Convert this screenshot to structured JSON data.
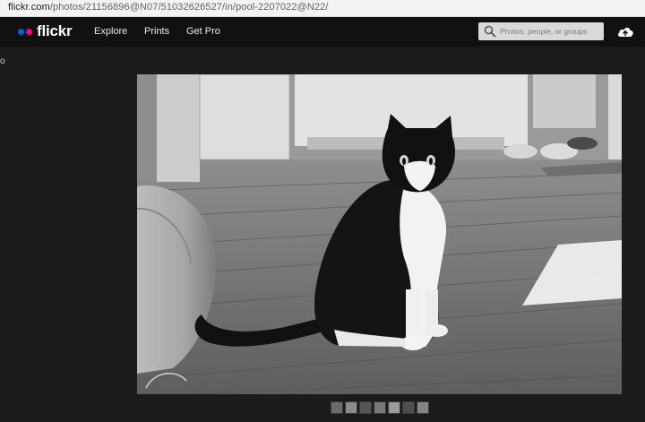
{
  "browser": {
    "url_host": "flickr.com",
    "url_path": "/photos/21156896@N07/51032626527/in/pool-2207022@N22/"
  },
  "header": {
    "logo_text": "flickr",
    "brand_colors": {
      "blue": "#0063dc",
      "pink": "#ff0084"
    },
    "nav": {
      "explore": "Explore",
      "prints": "Prints",
      "get_pro": "Get Pro"
    },
    "search_placeholder": "Photos, people, or groups",
    "search_icon": "search-icon",
    "upload_icon": "cloud-upload-icon"
  },
  "page": {
    "edge_text": "o"
  },
  "photo": {
    "subject": "black-and-white-cat-photo"
  },
  "thumbnails": [
    {
      "shade": "#6a6a6a"
    },
    {
      "shade": "#8c8c8c"
    },
    {
      "shade": "#555555"
    },
    {
      "shade": "#787878"
    },
    {
      "shade": "#9a9a9a"
    },
    {
      "shade": "#4e4e4e"
    },
    {
      "shade": "#858585"
    }
  ]
}
